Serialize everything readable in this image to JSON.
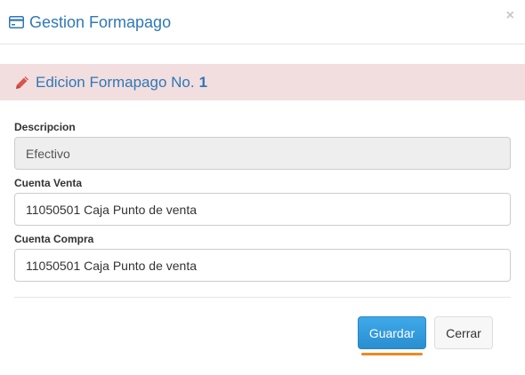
{
  "header": {
    "title": "Gestion Formapago",
    "close_label": "×"
  },
  "alert": {
    "title": "Edicion Formapago No.",
    "number": "1"
  },
  "form": {
    "descripcion": {
      "label": "Descripcion",
      "value": "Efectivo"
    },
    "cuenta_venta": {
      "label": "Cuenta Venta",
      "value": "11050501 Caja Punto de venta"
    },
    "cuenta_compra": {
      "label": "Cuenta Compra",
      "value": "11050501 Caja Punto de venta"
    }
  },
  "footer": {
    "save_label": "Guardar",
    "close_label": "Cerrar"
  },
  "colors": {
    "accent": "#2f78b7",
    "alert_bg": "#f2dede",
    "primary_button": "#2a8ed1",
    "pencil": "#d9534f",
    "focus_underline": "#ee8a1e"
  },
  "icons": {
    "title_icon": "credit-card-icon",
    "alert_icon": "pencil-icon",
    "close_icon": "close-icon"
  }
}
